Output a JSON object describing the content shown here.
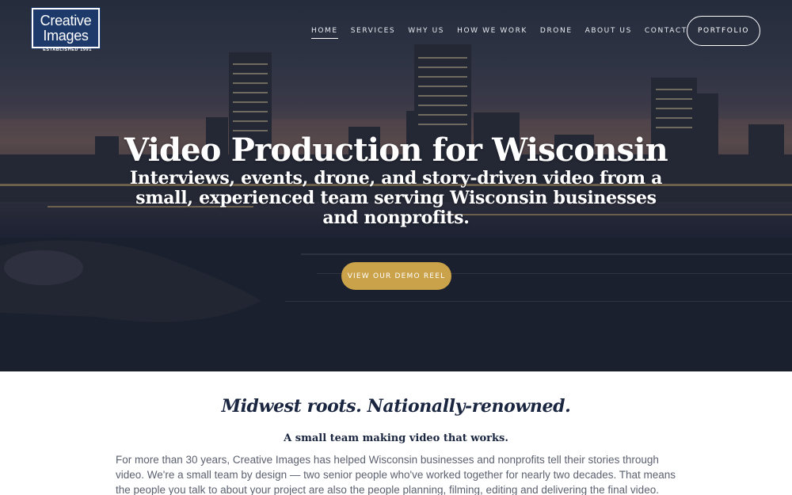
{
  "logo": {
    "line1": "Creative",
    "line2": "Images",
    "established": "ESTABLISHED 1991"
  },
  "nav": {
    "items": [
      {
        "label": "HOME",
        "active": true
      },
      {
        "label": "SERVICES",
        "active": false
      },
      {
        "label": "WHY US",
        "active": false
      },
      {
        "label": "HOW WE WORK",
        "active": false
      },
      {
        "label": "DRONE",
        "active": false
      },
      {
        "label": "ABOUT US",
        "active": false
      },
      {
        "label": "CONTACT",
        "active": false
      }
    ],
    "portfolio_label": "PORTFOLIO"
  },
  "hero": {
    "title": "Video Production for Wisconsin",
    "subtitle": "Interviews, events, drone, and story-driven video from a small, experienced team serving Wisconsin businesses and nonprofits.",
    "cta_label": "VIEW OUR DEMO REEL",
    "background_image": "city-skyline-at-dusk"
  },
  "content": {
    "tagline": "Midwest roots. Nationally-renowned.",
    "subhead": "A small team making video that works.",
    "body": "For more than 30 years, Creative Images has helped Wisconsin businesses and nonprofits tell their stories through video. We're a small team by design — two senior people who've worked together for nearly two decades. That means the people you talk to about your project are also the people planning, filming, editing and delivering the final video."
  },
  "colors": {
    "brand_navy": "#1d3a6b",
    "cta_gold": "#c9a24a",
    "heading_navy": "#1a2540",
    "body_gray": "#5c6170"
  }
}
